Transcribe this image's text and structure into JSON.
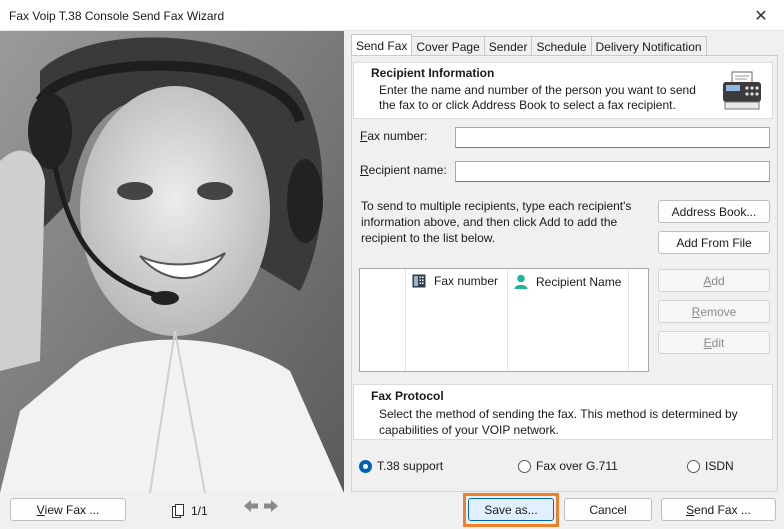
{
  "window": {
    "title": "Fax Voip T.38 Console Send Fax Wizard",
    "close_glyph": "✕"
  },
  "tabs": [
    {
      "label": "Send Fax"
    },
    {
      "label": "Cover Page"
    },
    {
      "label": "Sender"
    },
    {
      "label": "Schedule"
    },
    {
      "label": "Delivery Notification"
    }
  ],
  "recipient_info": {
    "title": "Recipient Information",
    "text": "Enter the name and number of the person you want to send the fax to or click Address Book to select a fax recipient."
  },
  "fields": {
    "fax_number": {
      "label_first": "F",
      "label_rest": "ax number:",
      "value": ""
    },
    "recipient_name": {
      "label_first": "R",
      "label_rest": "ecipient name:",
      "value": ""
    }
  },
  "help_text": "To send to multiple recipients, type each recipient's information above, and then click Add to add the recipient to the list below.",
  "buttons": {
    "address_book": "Address Book...",
    "add_from_file": "Add From File",
    "add_first": "A",
    "add_rest": "dd",
    "remove_first": "R",
    "remove_rest": "emove",
    "edit_first": "E",
    "edit_rest": "dit",
    "view_fax_first": "V",
    "view_fax_rest": "iew Fax ...",
    "save_as": "Save as...",
    "cancel": "Cancel",
    "send_fax_first": "S",
    "send_fax_rest": "end Fax ..."
  },
  "list": {
    "columns": [
      "Fax number",
      "Recipient Name"
    ]
  },
  "fax_protocol": {
    "title": "Fax Protocol",
    "text": "Select the method of sending the fax. This method is determined by capabilities of your VOIP network.",
    "options": [
      {
        "label": "T.38 support",
        "selected": true
      },
      {
        "label": "Fax over G.711",
        "selected": false
      },
      {
        "label": "ISDN",
        "selected": false
      }
    ]
  },
  "pager": {
    "text": "1/1"
  },
  "colors": {
    "accent": "#0067c0",
    "highlight": "#f07f2c"
  }
}
